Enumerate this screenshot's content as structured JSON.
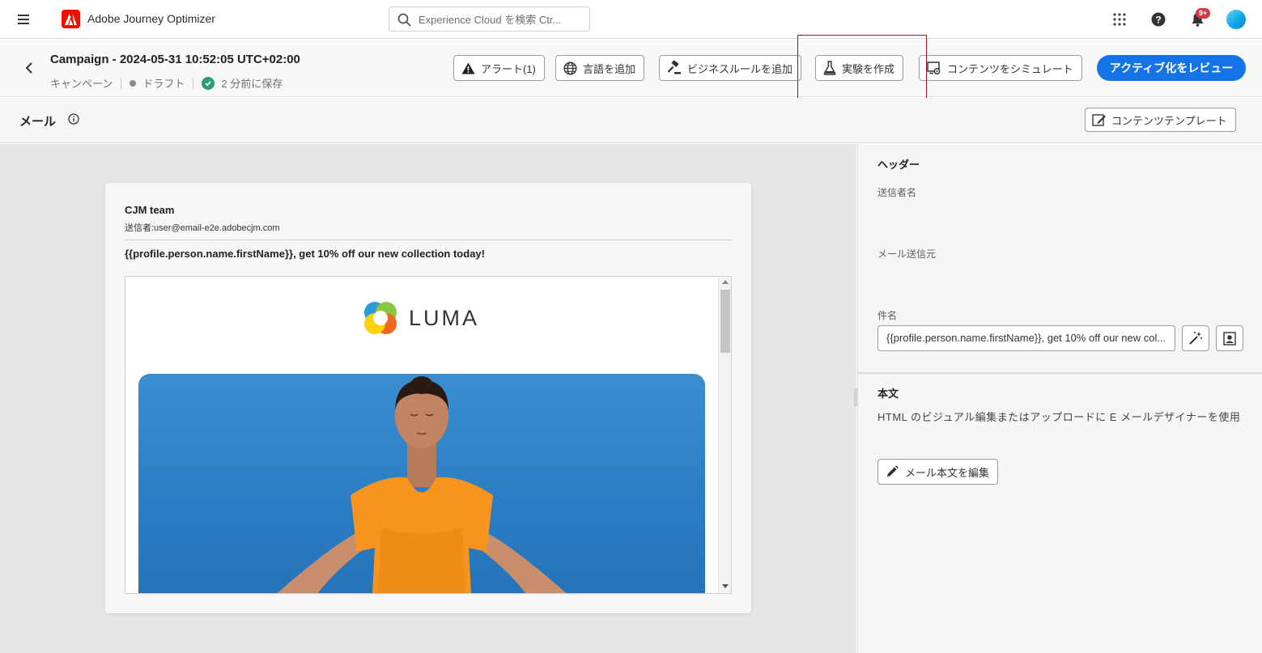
{
  "app": {
    "title": "Adobe Journey Optimizer"
  },
  "search": {
    "placeholder": "Experience Cloud を検索 Ctr..."
  },
  "notifications": {
    "badge": "9+"
  },
  "campaign": {
    "title": "Campaign - 2024-05-31 10:52:05 UTC+02:00",
    "type": "キャンペーン",
    "status": "ドラフト",
    "saved": "2 分前に保存"
  },
  "toolbar": {
    "alert": "アラート(1)",
    "add_language": "言語を追加",
    "add_business_rule": "ビジネスルールを追加",
    "create_experiment": "実験を作成",
    "simulate_content": "コンテンツをシミュレート",
    "review_activate": "アクティブ化をレビュー"
  },
  "section": {
    "title": "メール",
    "content_template": "コンテンツテンプレート"
  },
  "preview": {
    "sender_name": "CJM team",
    "sender_address": "送信者:user@email-e2e.adobecjm.com",
    "subject": "{{profile.person.name.firstName}}, get 10% off our new collection today!",
    "brand": "LUMA"
  },
  "panel": {
    "header_title": "ヘッダー",
    "sender_name_label": "送信者名",
    "from_email_label": "メール送信元",
    "subject_label": "件名",
    "subject_value": "{{profile.person.name.firstName}}, get 10% off our new col...",
    "body_title": "本文",
    "body_description": "HTML のビジュアル編集またはアップロードに E メールデザイナーを使用",
    "edit_body": "メール本文を編集"
  },
  "colors": {
    "accent": "#1473e6",
    "adobe_red": "#eb1000",
    "saved_green": "#2d9d78",
    "highlight": "#8b1a1a"
  }
}
